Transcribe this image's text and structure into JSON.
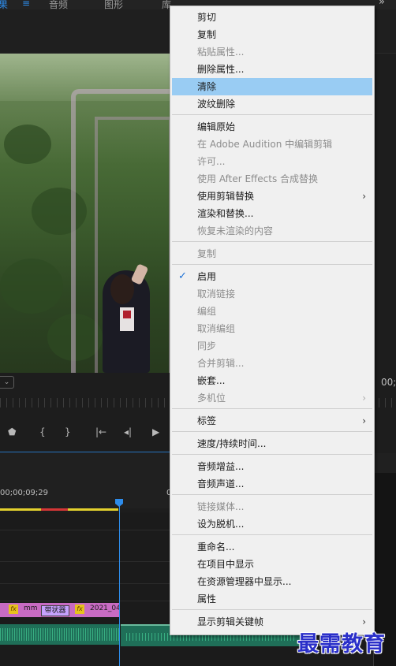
{
  "topbar": {
    "tabs": [
      "果",
      "音频",
      "图形",
      "库"
    ],
    "menu_icon": "hamburger-menu-icon",
    "more_icon": "double-chevron-right-icon"
  },
  "monitor": {
    "timecode_right": "00;",
    "dropdown_icon": "chevron-down-icon"
  },
  "timeline": {
    "timecode": "00;00;09;29",
    "timecode_right": "0",
    "clip_labels": [
      "fx",
      "mm",
      "fx",
      "2021_04"
    ],
    "clip_box_label": "带状器",
    "colors": {
      "playhead": "#2d8ceb",
      "video_clip": "#c86bc3",
      "audio_clip": "#1f6f58",
      "workbar_yellow": "#e3d12d",
      "workbar_red": "#d53636"
    }
  },
  "context_menu": {
    "highlight_color": "#99ccf3",
    "items": [
      {
        "label": "剪切",
        "disabled": false
      },
      {
        "label": "复制",
        "disabled": false
      },
      {
        "label": "粘贴属性...",
        "disabled": true
      },
      {
        "label": "删除属性...",
        "disabled": false
      },
      {
        "label": "清除",
        "disabled": false,
        "highlighted": true
      },
      {
        "label": "波纹删除",
        "disabled": false
      },
      {
        "label": "编辑原始",
        "disabled": false
      },
      {
        "label": "在 Adobe Audition 中编辑剪辑",
        "disabled": true
      },
      {
        "label": "许可...",
        "disabled": true
      },
      {
        "label": "使用 After Effects 合成替换",
        "disabled": true
      },
      {
        "label": "使用剪辑替换",
        "disabled": false,
        "submenu": true
      },
      {
        "label": "渲染和替换...",
        "disabled": false
      },
      {
        "label": "恢复未渲染的内容",
        "disabled": true
      },
      {
        "label": "复制",
        "disabled": true
      },
      {
        "label": "启用",
        "disabled": false,
        "checked": true
      },
      {
        "label": "取消链接",
        "disabled": true
      },
      {
        "label": "编组",
        "disabled": true
      },
      {
        "label": "取消编组",
        "disabled": true
      },
      {
        "label": "同步",
        "disabled": true
      },
      {
        "label": "合并剪辑...",
        "disabled": true
      },
      {
        "label": "嵌套...",
        "disabled": false
      },
      {
        "label": "多机位",
        "disabled": true,
        "submenu": true
      },
      {
        "label": "标签",
        "disabled": false,
        "submenu": true
      },
      {
        "label": "速度/持续时间...",
        "disabled": false
      },
      {
        "label": "音频增益...",
        "disabled": false
      },
      {
        "label": "音频声道...",
        "disabled": false
      },
      {
        "label": "链接媒体...",
        "disabled": true
      },
      {
        "label": "设为脱机...",
        "disabled": false
      },
      {
        "label": "重命名...",
        "disabled": false
      },
      {
        "label": "在项目中显示",
        "disabled": false
      },
      {
        "label": "在资源管理器中显示...",
        "disabled": false
      },
      {
        "label": "属性",
        "disabled": false
      },
      {
        "label": "显示剪辑关键帧",
        "disabled": false,
        "submenu": true
      }
    ],
    "submenu_arrow": "›",
    "check_mark": "✓"
  },
  "watermark": {
    "text": "最需教育"
  }
}
